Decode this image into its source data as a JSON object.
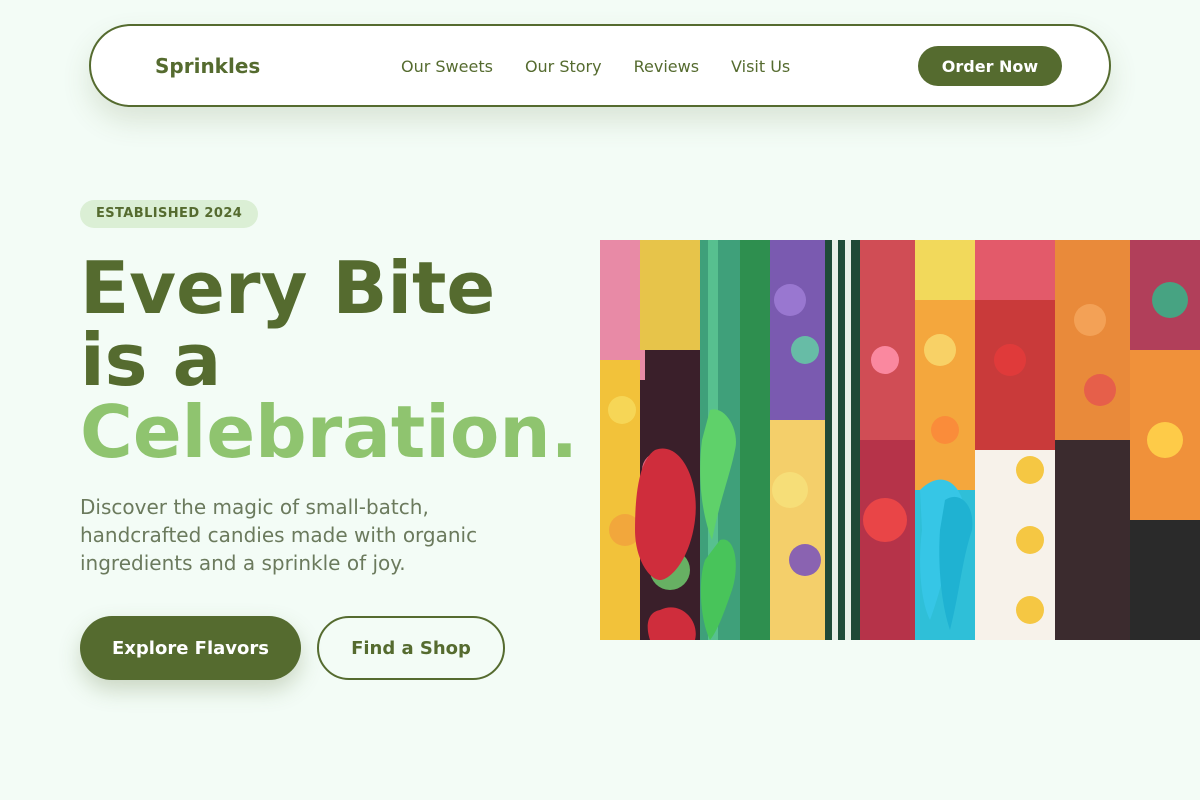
{
  "nav": {
    "brand": "Sprinkles",
    "links": [
      "Our Sweets",
      "Our Story",
      "Reviews",
      "Visit Us"
    ],
    "cta": "Order Now"
  },
  "hero": {
    "badge": "ESTABLISHED 2024",
    "headline_line1": "Every Bite",
    "headline_line2": "is a",
    "headline_accent": "Celebration.",
    "description": "Discover the magic of small-batch, handcrafted candies made with organic ingredients and a sprinkle of joy.",
    "primary_button": "Explore Flavors",
    "secondary_button": "Find a Shop"
  },
  "colors": {
    "background": "#f3fcf6",
    "primary": "#556b2f",
    "accent": "#8fc46f",
    "badge_bg": "#dbefd5",
    "body_text": "#6b7a5d"
  },
  "icons": [
    "candy-photo"
  ]
}
